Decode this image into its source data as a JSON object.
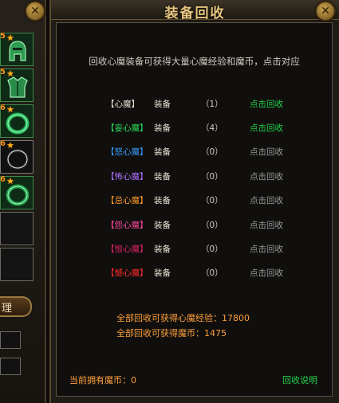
{
  "window": {
    "title": "装备回收"
  },
  "intro_text": "回收心魔装备可获得大量心魔经验和魔币，点击对应",
  "rows": [
    {
      "name": "【心魔】",
      "type": "装备",
      "count": "（1）",
      "action": "点击回收",
      "name_color": "#e8e2d2",
      "action_color": "#25d04a"
    },
    {
      "name": "【妄心魔】",
      "type": "装备",
      "count": "（4）",
      "action": "点击回收",
      "name_color": "#2fe05a",
      "action_color": "#25d04a"
    },
    {
      "name": "【怒心魔】",
      "type": "装备",
      "count": "（0）",
      "action": "点击回收",
      "name_color": "#3a9cff",
      "action_color": "#9a9a9a"
    },
    {
      "name": "【怖心魔】",
      "type": "装备",
      "count": "（0）",
      "action": "点击回收",
      "name_color": "#b070ff",
      "action_color": "#9a9a9a"
    },
    {
      "name": "【忌心魔】",
      "type": "装备",
      "count": "（0）",
      "action": "点击回收",
      "name_color": "#ff9c2e",
      "action_color": "#9a9a9a"
    },
    {
      "name": "【怨心魔】",
      "type": "装备",
      "count": "（0）",
      "action": "点击回收",
      "name_color": "#ff4aa0",
      "action_color": "#9a9a9a"
    },
    {
      "name": "【恨心魔】",
      "type": "装备",
      "count": "（0）",
      "action": "点击回收",
      "name_color": "#e0206a",
      "action_color": "#9a9a9a"
    },
    {
      "name": "【憾心魔】",
      "type": "装备",
      "count": "（0）",
      "action": "点击回收",
      "name_color": "#ff2a2a",
      "action_color": "#9a9a9a"
    }
  ],
  "summary": {
    "exp": "全部回收可获得心魔经验：17800",
    "coin": "全部回收可获得魔币：1475"
  },
  "footer": {
    "currency": "当前拥有魔币：0",
    "help": "回收说明"
  },
  "left_panel": {
    "slots": [
      {
        "level": "5",
        "icon": "helmet-icon"
      },
      {
        "level": "5",
        "icon": "armor-icon"
      },
      {
        "level": "6",
        "icon": "ring-icon"
      },
      {
        "level": "6",
        "icon": "bracelet-icon"
      },
      {
        "level": "6",
        "icon": "ring-icon"
      }
    ],
    "organize_label": "理"
  },
  "close_glyph": "✕"
}
